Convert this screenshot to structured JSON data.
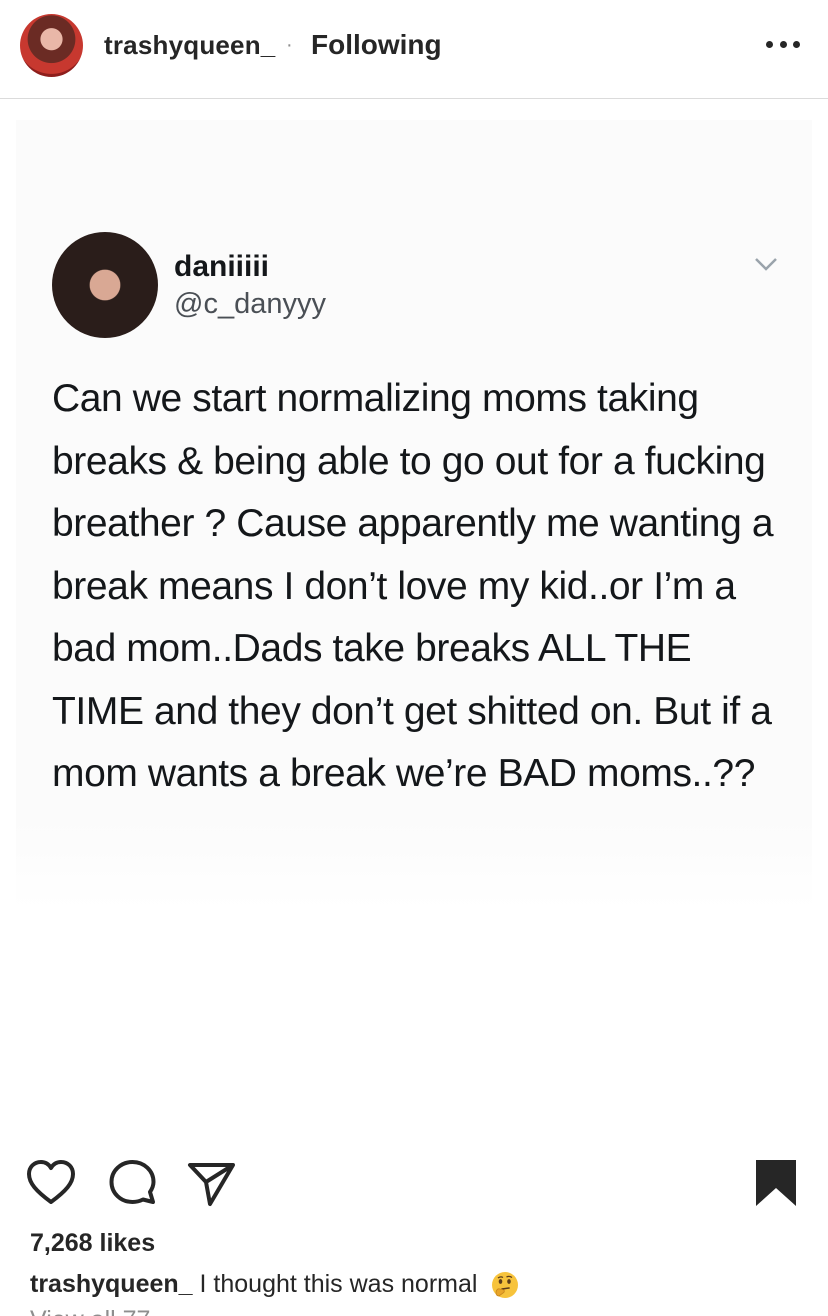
{
  "header": {
    "username": "trashyqueen_",
    "separator": "·",
    "follow_status": "Following"
  },
  "tweet": {
    "name": "daniiiii",
    "handle": "@c_danyyy",
    "text": "Can we start normalizing moms taking breaks & being able to go out for a fucking breather ? Cause apparently me wanting a break means I don’t love my kid..or I’m a bad mom..Dads take breaks ALL THE TIME and they don’t get shitted on. But if a mom wants a break we’re BAD moms..??"
  },
  "post": {
    "likes": "7,268 likes",
    "caption_user": "trashyqueen_",
    "caption_text": "I thought this was normal",
    "caption_emoji": "thinking-face-emoji",
    "view_comments": "View all 77"
  },
  "icons": {
    "like": "heart-outline-icon",
    "comment": "comment-bubble-icon",
    "share": "paper-plane-icon",
    "save": "bookmark-filled-icon",
    "more": "more-options-icon"
  },
  "colors": {
    "text": "#262626",
    "secondary": "#8e8e8e",
    "divider": "#dbdbdb"
  }
}
